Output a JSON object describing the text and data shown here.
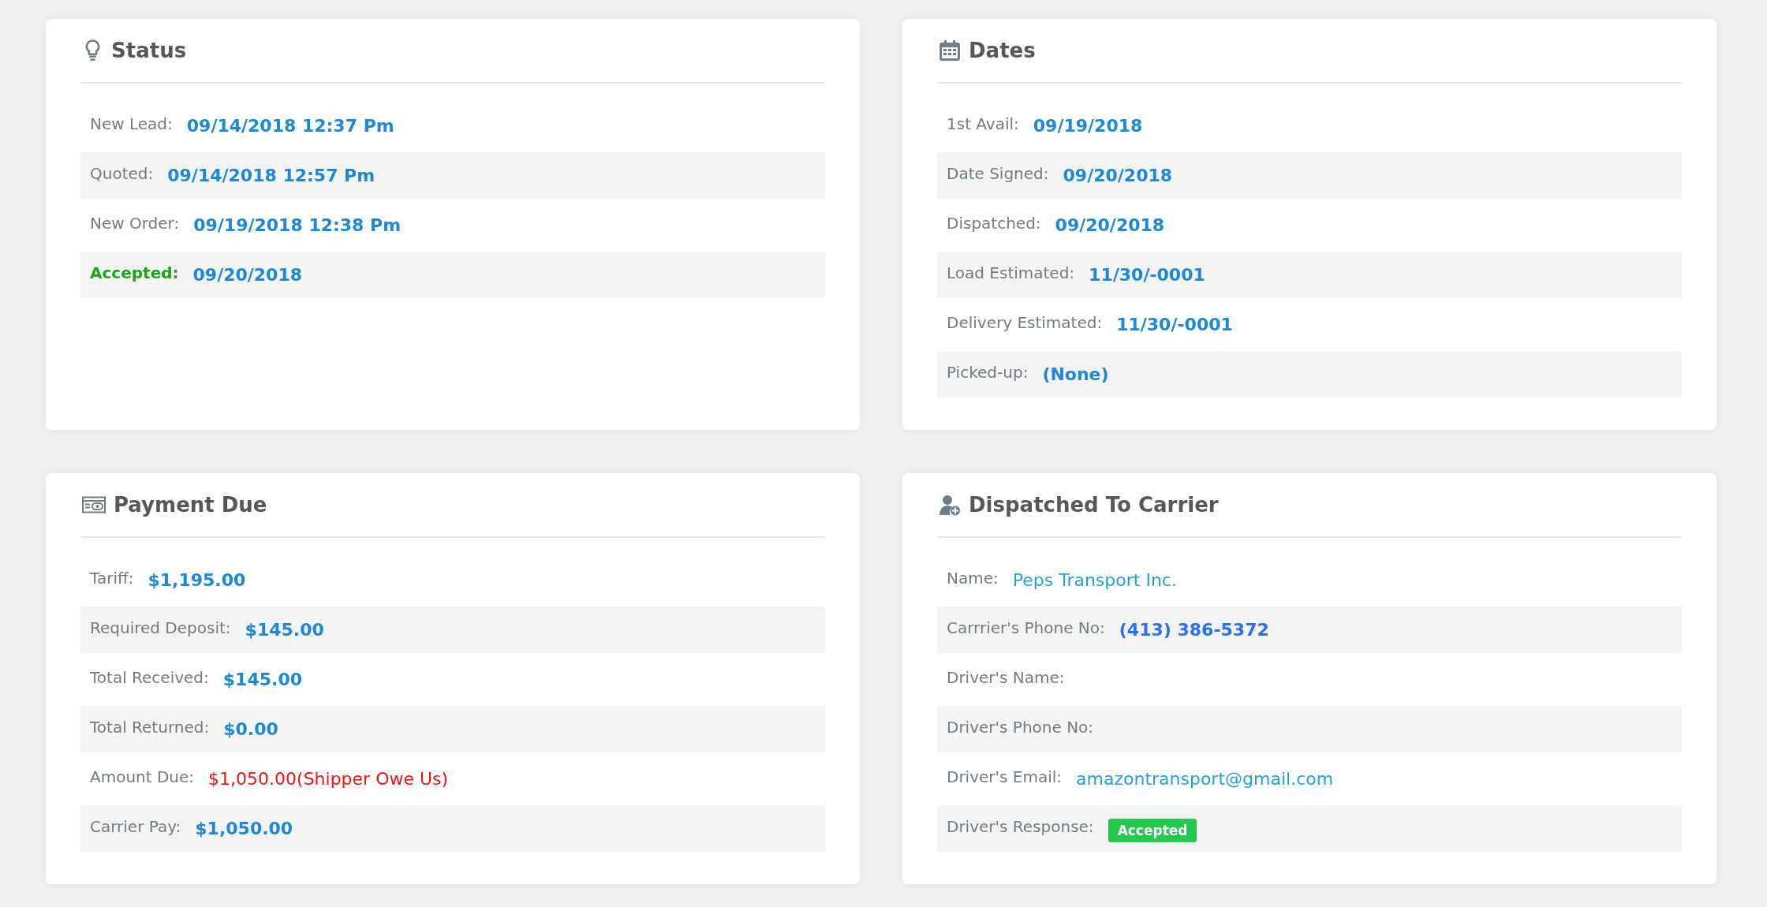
{
  "status": {
    "title": "Status",
    "rows": [
      {
        "label": "New Lead:",
        "value": "09/14/2018 12:37 Pm",
        "kind": "value",
        "current": false
      },
      {
        "label": "Quoted:",
        "value": "09/14/2018 12:57 Pm",
        "kind": "value",
        "current": false
      },
      {
        "label": "New Order:",
        "value": "09/19/2018 12:38 Pm",
        "kind": "value",
        "current": false
      },
      {
        "label": "Accepted:",
        "value": "09/20/2018",
        "kind": "value",
        "current": true
      }
    ]
  },
  "dates": {
    "title": "Dates",
    "rows": [
      {
        "label": "1st Avail:",
        "value": "09/19/2018",
        "kind": "value"
      },
      {
        "label": "Date Signed:",
        "value": "09/20/2018",
        "kind": "value"
      },
      {
        "label": "Dispatched:",
        "value": "09/20/2018",
        "kind": "value"
      },
      {
        "label": "Load Estimated:",
        "value": "11/30/-0001",
        "kind": "value"
      },
      {
        "label": "Delivery Estimated:",
        "value": "11/30/-0001",
        "kind": "value"
      },
      {
        "label": "Picked-up:",
        "value": "(None)",
        "kind": "value"
      }
    ]
  },
  "payment_due": {
    "title": "Payment Due",
    "rows": [
      {
        "label": "Tariff:",
        "value": "$1,195.00",
        "kind": "value"
      },
      {
        "label": "Required Deposit:",
        "value": "$145.00",
        "kind": "value"
      },
      {
        "label": "Total Received:",
        "value": "$145.00",
        "kind": "value"
      },
      {
        "label": "Total Returned:",
        "value": "$0.00",
        "kind": "value"
      },
      {
        "label": "Amount Due:",
        "value": "$1,050.00(Shipper Owe Us)",
        "kind": "alert"
      },
      {
        "label": "Carrier Pay:",
        "value": "$1,050.00",
        "kind": "value"
      }
    ]
  },
  "dispatched_to_carrier": {
    "title": "Dispatched To Carrier",
    "rows": [
      {
        "label": "Name:",
        "value": "Peps Transport Inc.",
        "kind": "link"
      },
      {
        "label": "Carrrier's Phone No:",
        "value": "(413) 386-5372",
        "kind": "phone"
      },
      {
        "label": "Driver's Name:"
      },
      {
        "label": "Driver's Phone No:"
      },
      {
        "label": "Driver's Email:",
        "value": "amazontransport@gmail.com",
        "kind": "link"
      },
      {
        "label": "Driver's Response:",
        "value": "Accepted",
        "kind": "badge"
      }
    ]
  }
}
